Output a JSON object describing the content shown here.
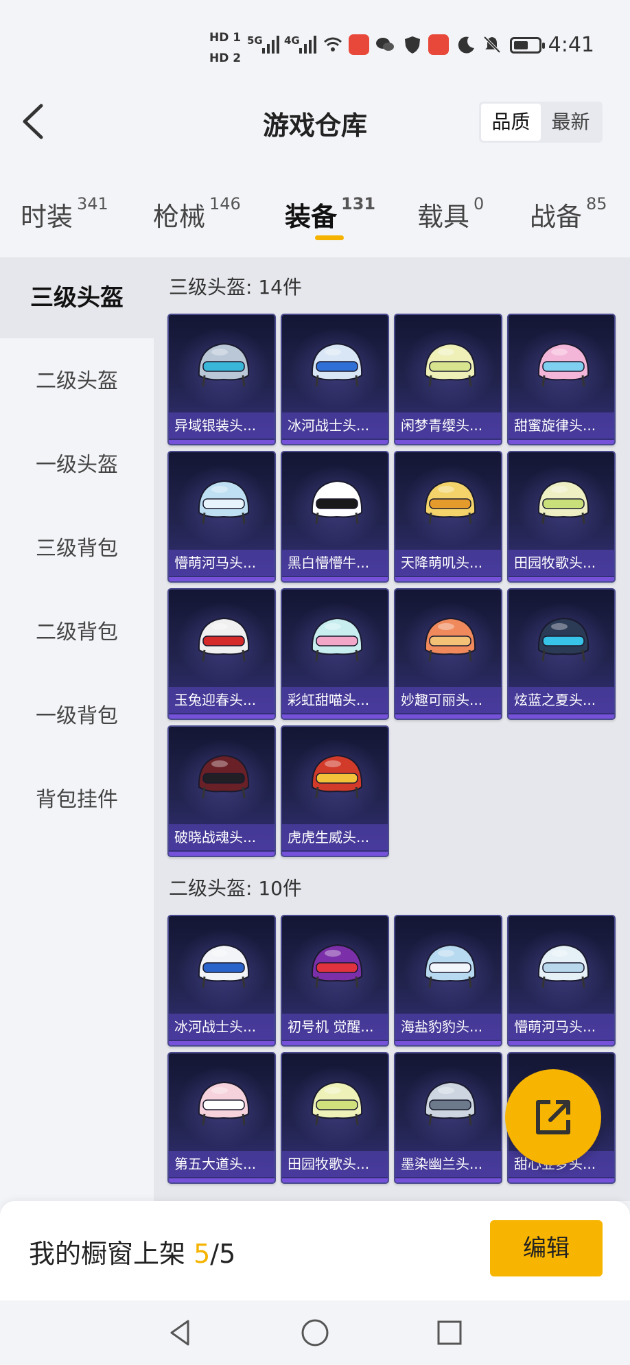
{
  "status_bar": {
    "hd1": "HD 1",
    "hd2": "HD 2",
    "net1": "5G",
    "net2": "4G",
    "time": "4:41",
    "icons": [
      "signal-icon",
      "wifi-icon",
      "huawei-app-icon",
      "wechat-icon",
      "shield-icon",
      "huawei-app-icon",
      "moon-icon",
      "mute-bell-icon",
      "battery-icon"
    ]
  },
  "header": {
    "title": "游戏仓库",
    "sort_options": [
      "品质",
      "最新"
    ],
    "sort_active": "品质"
  },
  "tabs": [
    {
      "label": "时装",
      "count": "341"
    },
    {
      "label": "枪械",
      "count": "146"
    },
    {
      "label": "装备",
      "count": "131",
      "active": true
    },
    {
      "label": "载具",
      "count": "0"
    },
    {
      "label": "战备",
      "count": "85"
    }
  ],
  "sidebar": [
    {
      "label": "三级头盔",
      "active": true
    },
    {
      "label": "二级头盔"
    },
    {
      "label": "一级头盔"
    },
    {
      "label": "三级背包"
    },
    {
      "label": "二级背包"
    },
    {
      "label": "一级背包"
    },
    {
      "label": "背包挂件"
    }
  ],
  "sections": [
    {
      "title": "三级头盔: 14件",
      "items": [
        {
          "name": "异域银装头...",
          "color": "#b9c7d6",
          "accent": "#39b6d8"
        },
        {
          "name": "冰河战士头...",
          "color": "#d9e6f5",
          "accent": "#2f6fd6"
        },
        {
          "name": "闲梦青缨头...",
          "color": "#eef0b8",
          "accent": "#d8e58e"
        },
        {
          "name": "甜蜜旋律头...",
          "color": "#f4b6d8",
          "accent": "#7fd0f0"
        },
        {
          "name": "懵萌河马头...",
          "color": "#bfe0f3",
          "accent": "#e8f4fb"
        },
        {
          "name": "黑白懵懵牛...",
          "color": "#ffffff",
          "accent": "#1a1a1a"
        },
        {
          "name": "天降萌叽头...",
          "color": "#f3d36a",
          "accent": "#e59a2c"
        },
        {
          "name": "田园牧歌头...",
          "color": "#eef0c4",
          "accent": "#c9df7a"
        },
        {
          "name": "玉兔迎春头...",
          "color": "#f0f0f0",
          "accent": "#d42a2a"
        },
        {
          "name": "彩虹甜喵头...",
          "color": "#c8eef0",
          "accent": "#f2a6c8"
        },
        {
          "name": "妙趣可丽头...",
          "color": "#f08a5c",
          "accent": "#f3c276"
        },
        {
          "name": "炫蓝之夏头...",
          "color": "#2b3a55",
          "accent": "#37c4e8"
        },
        {
          "name": "破晓战魂头...",
          "color": "#6a2027",
          "accent": "#1f1f25"
        },
        {
          "name": "虎虎生威头...",
          "color": "#d23a2a",
          "accent": "#f3c23a"
        }
      ]
    },
    {
      "title": "二级头盔: 10件",
      "items": [
        {
          "name": "冰河战士头...",
          "color": "#f2f4f8",
          "accent": "#2a63c9"
        },
        {
          "name": "初号机 觉醒...",
          "color": "#7b2fa8",
          "accent": "#e0333f"
        },
        {
          "name": "海盐豹豹头...",
          "color": "#b8daf0",
          "accent": "#f0f6fb"
        },
        {
          "name": "懵萌河马头...",
          "color": "#e6f1f7",
          "accent": "#b9d8ec"
        },
        {
          "name": "第五大道头...",
          "color": "#f6d2dc",
          "accent": "#ffffff"
        },
        {
          "name": "田园牧歌头...",
          "color": "#eef2b8",
          "accent": "#cfe07c"
        },
        {
          "name": "墨染幽兰头...",
          "color": "#cdd6e0",
          "accent": "#6c7a8c"
        },
        {
          "name": "甜心业梦头...",
          "color": "#f6c9d8",
          "accent": "#ffffff"
        }
      ]
    }
  ],
  "bottom": {
    "shelf_label": "我的橱窗上架",
    "shelf_current": "5",
    "shelf_sep": "/",
    "shelf_total": "5",
    "edit_label": "编辑"
  }
}
